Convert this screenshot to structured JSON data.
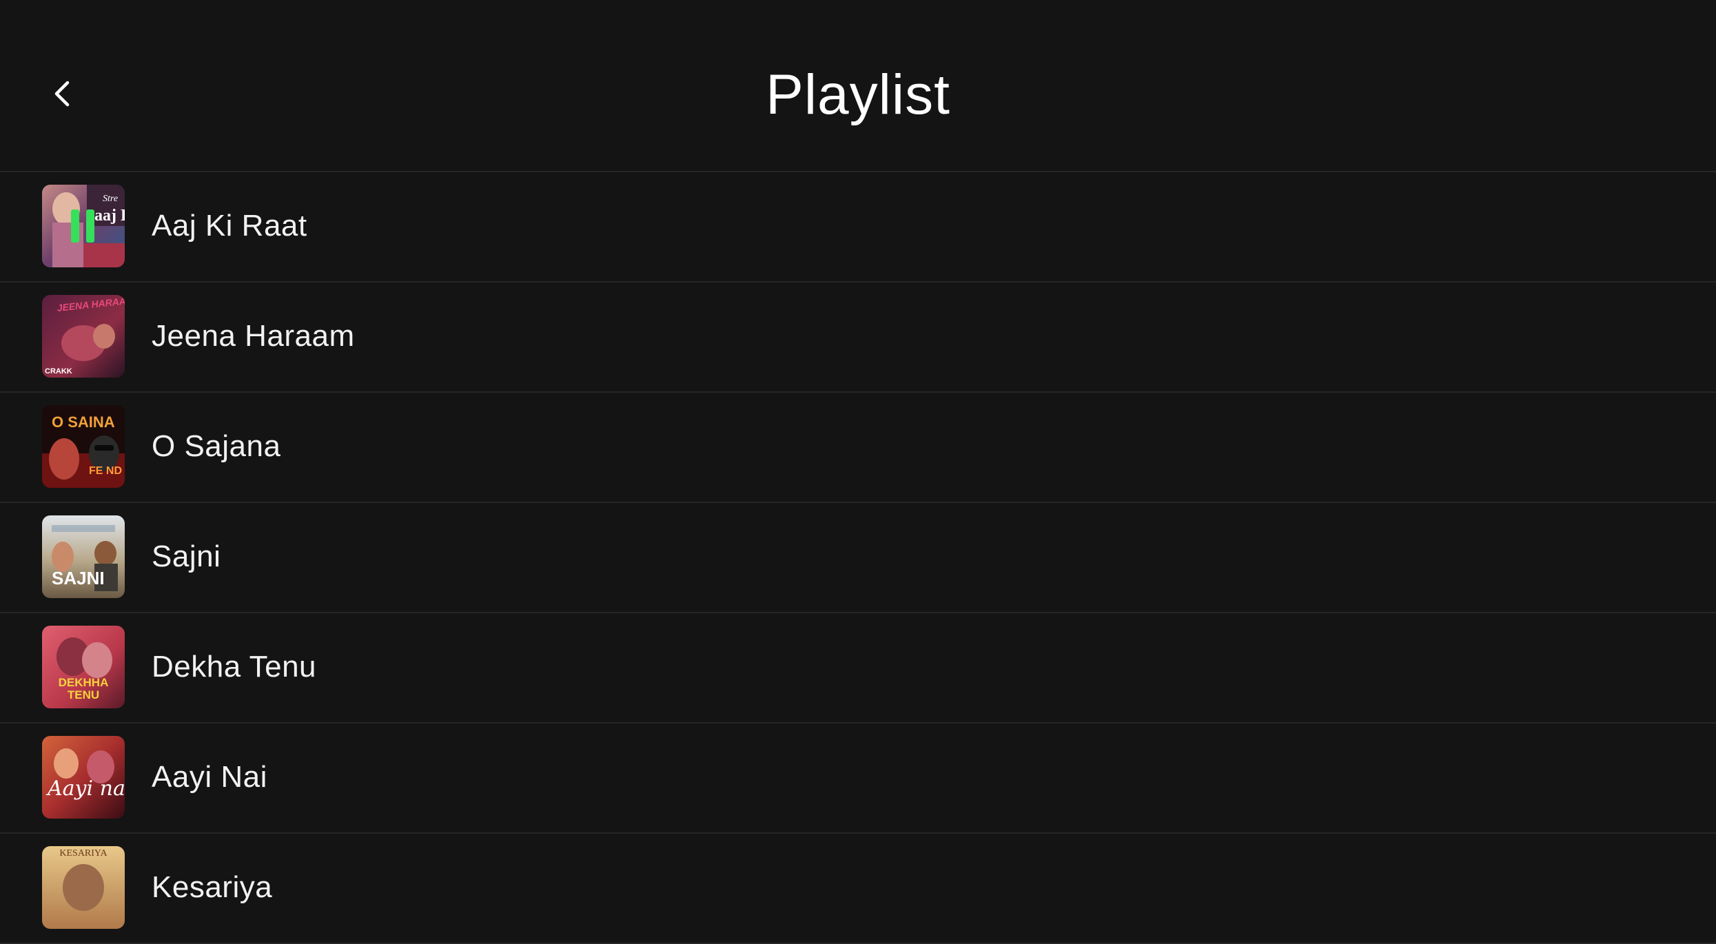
{
  "header": {
    "title": "Playlist",
    "back_icon": "chevron-left-icon"
  },
  "playlist": [
    {
      "title": "Aaj Ki Raat",
      "playing": true,
      "thumb_text": "aaj Ki",
      "thumb_top": "Stre"
    },
    {
      "title": "Jeena Haraam",
      "playing": false,
      "thumb_text": "JEENA HARAAM",
      "thumb_bottom": "CRAKK"
    },
    {
      "title": "O Sajana",
      "playing": false,
      "thumb_text": "O SAINA",
      "thumb_bottom": "FE ND"
    },
    {
      "title": "Sajni",
      "playing": false,
      "thumb_text": "SAJNI"
    },
    {
      "title": "Dekha Tenu",
      "playing": false,
      "thumb_text": "DEKHHA TENU"
    },
    {
      "title": "Aayi Nai",
      "playing": false,
      "thumb_text": "Aayi na"
    },
    {
      "title": "Kesariya",
      "playing": false,
      "thumb_text": "KESARIYA"
    }
  ],
  "colors": {
    "background": "#141414",
    "divider": "#262626",
    "text": "#ffffff",
    "playing_indicator": "#35e05a"
  }
}
